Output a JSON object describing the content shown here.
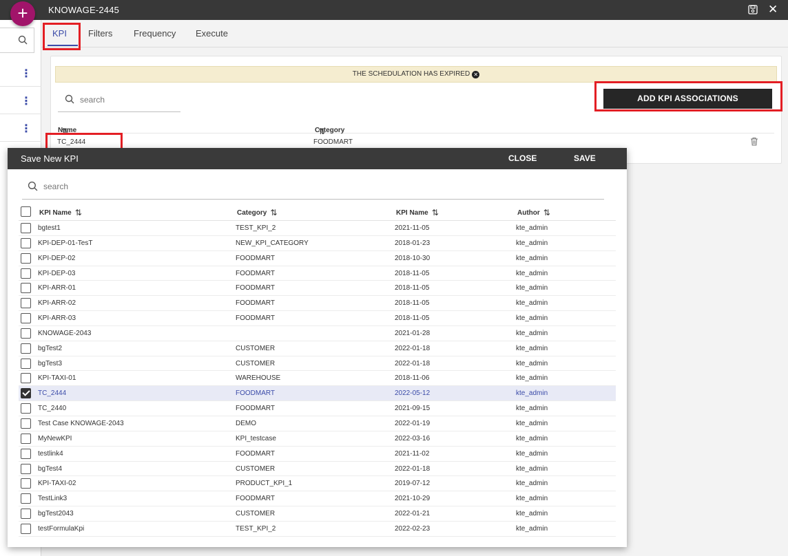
{
  "window": {
    "title": "KNOWAGE-2445"
  },
  "tabs": [
    {
      "label": "KPI",
      "active": true
    },
    {
      "label": "Filters"
    },
    {
      "label": "Frequency"
    },
    {
      "label": "Execute"
    }
  ],
  "banner": {
    "text": "THE SCHEDULATION HAS EXPIRED"
  },
  "card": {
    "search_placeholder": "search",
    "add_button": "ADD KPI ASSOCIATIONS",
    "columns": {
      "name": "Name",
      "category": "Category"
    },
    "rows": [
      {
        "name": "TC_2444",
        "category": "FOODMART"
      }
    ]
  },
  "modal": {
    "title": "Save New KPI",
    "close_label": "CLOSE",
    "save_label": "SAVE",
    "search_placeholder": "search",
    "columns": {
      "kpi_name": "KPI Name",
      "category": "Category",
      "date": "KPI Name",
      "author": "Author"
    },
    "rows": [
      {
        "name": "bgtest1",
        "category": "TEST_KPI_2",
        "date": "2021-11-05",
        "author": "kte_admin",
        "checked": false
      },
      {
        "name": "KPI-DEP-01-TesT",
        "category": "NEW_KPI_CATEGORY",
        "date": "2018-01-23",
        "author": "kte_admin",
        "checked": false
      },
      {
        "name": "KPI-DEP-02",
        "category": "FOODMART",
        "date": "2018-10-30",
        "author": "kte_admin",
        "checked": false
      },
      {
        "name": "KPI-DEP-03",
        "category": "FOODMART",
        "date": "2018-11-05",
        "author": "kte_admin",
        "checked": false
      },
      {
        "name": "KPI-ARR-01",
        "category": "FOODMART",
        "date": "2018-11-05",
        "author": "kte_admin",
        "checked": false
      },
      {
        "name": "KPI-ARR-02",
        "category": "FOODMART",
        "date": "2018-11-05",
        "author": "kte_admin",
        "checked": false
      },
      {
        "name": "KPI-ARR-03",
        "category": "FOODMART",
        "date": "2018-11-05",
        "author": "kte_admin",
        "checked": false
      },
      {
        "name": "KNOWAGE-2043",
        "category": "",
        "date": "2021-01-28",
        "author": "kte_admin",
        "checked": false
      },
      {
        "name": "bgTest2",
        "category": "CUSTOMER",
        "date": "2022-01-18",
        "author": "kte_admin",
        "checked": false
      },
      {
        "name": "bgTest3",
        "category": "CUSTOMER",
        "date": "2022-01-18",
        "author": "kte_admin",
        "checked": false
      },
      {
        "name": "KPI-TAXI-01",
        "category": "WAREHOUSE",
        "date": "2018-11-06",
        "author": "kte_admin",
        "checked": false
      },
      {
        "name": "TC_2444",
        "category": "FOODMART",
        "date": "2022-05-12",
        "author": "kte_admin",
        "checked": true
      },
      {
        "name": "TC_2440",
        "category": "FOODMART",
        "date": "2021-09-15",
        "author": "kte_admin",
        "checked": false
      },
      {
        "name": "Test Case KNOWAGE-2043",
        "category": "DEMO",
        "date": "2022-01-19",
        "author": "kte_admin",
        "checked": false
      },
      {
        "name": "MyNewKPI",
        "category": "KPI_testcase",
        "date": "2022-03-16",
        "author": "kte_admin",
        "checked": false
      },
      {
        "name": "testlink4",
        "category": "FOODMART",
        "date": "2021-11-02",
        "author": "kte_admin",
        "checked": false
      },
      {
        "name": "bgTest4",
        "category": "CUSTOMER",
        "date": "2022-01-18",
        "author": "kte_admin",
        "checked": false
      },
      {
        "name": "KPI-TAXI-02",
        "category": "PRODUCT_KPI_1",
        "date": "2019-07-12",
        "author": "kte_admin",
        "checked": false
      },
      {
        "name": "TestLink3",
        "category": "FOODMART",
        "date": "2021-10-29",
        "author": "kte_admin",
        "checked": false
      },
      {
        "name": "bgTest2043",
        "category": "CUSTOMER",
        "date": "2022-01-21",
        "author": "kte_admin",
        "checked": false
      },
      {
        "name": "testFormulaKpi",
        "category": "TEST_KPI_2",
        "date": "2022-02-23",
        "author": "kte_admin",
        "checked": false
      }
    ]
  },
  "colors": {
    "accent": "#3b4ba8",
    "fab": "#a1146a",
    "highlight": "#e31e24",
    "header": "#383838"
  },
  "icons": {
    "add": "plus-icon",
    "save": "floppy-icon",
    "close": "close-icon",
    "search": "search-icon",
    "sort": "sort-icon",
    "delete": "trash-icon",
    "more": "kebab-icon"
  }
}
